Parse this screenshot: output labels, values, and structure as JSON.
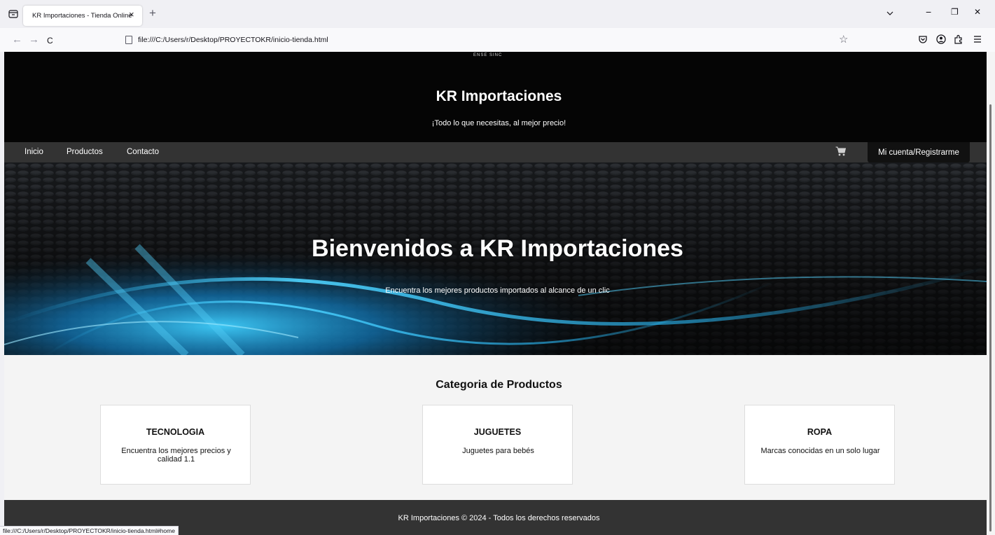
{
  "browser": {
    "tab_title": "KR Importaciones - Tienda Online",
    "tab_close": "×",
    "new_tab": "+",
    "url": "file:///C:/Users/r/Desktop/PROYECTOKR/inicio-tienda.html",
    "status_url": "file:///C:/Users/r/Desktop/PROYECTOKR/inicio-tienda.html#home",
    "nav_back": "←",
    "nav_forward": "→",
    "nav_reload": "C",
    "window_minimize": "−",
    "window_restore": "❐",
    "window_close": "✕",
    "bookmark_star": "☆"
  },
  "site": {
    "logo_text": "ENSE SINC",
    "title": "KR Importaciones",
    "tagline": "¡Todo lo que necesitas, al mejor precio!",
    "nav": [
      "Inicio",
      "Productos",
      "Contacto"
    ],
    "account_label": "Mi cuenta/Registrarme"
  },
  "hero": {
    "title": "Bienvenidos a KR Importaciones",
    "subtitle": "Encuentra los mejores productos importados al alcance de un clic"
  },
  "categories": {
    "heading": "Categoria de Productos",
    "items": [
      {
        "title": "TECNOLOGIA",
        "description": "Encuentra los mejores precios y calidad 1.1"
      },
      {
        "title": "JUGUETES",
        "description": "Juguetes para bebés"
      },
      {
        "title": "ROPA",
        "description": "Marcas conocidas en un solo lugar"
      }
    ]
  },
  "footer": {
    "text": "KR Importaciones © 2024 - Todos los derechos reservados"
  },
  "colors": {
    "header_bg": "#050505",
    "nav_bg": "#333333",
    "account_bg": "#111111",
    "page_bg": "#f4f4f4",
    "hero_accent": "#1fb6f0"
  }
}
